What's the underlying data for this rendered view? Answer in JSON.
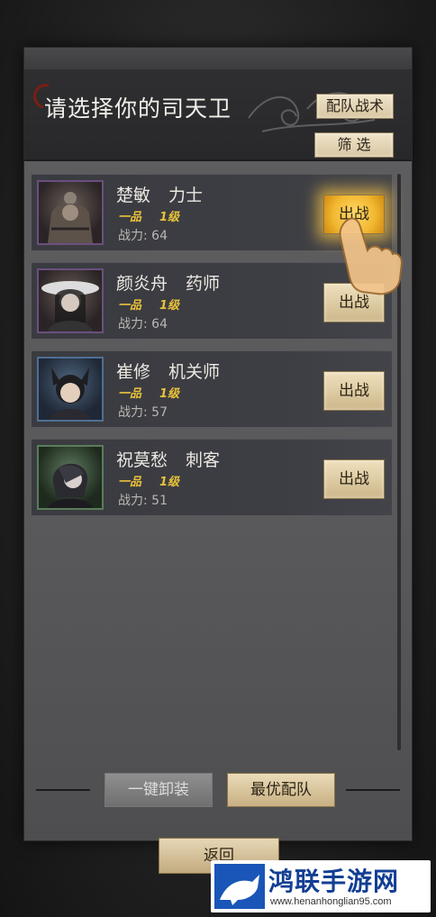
{
  "header": {
    "title": "请选择你的司天卫",
    "tactics_button": "配队战术",
    "filter_button": "筛 选"
  },
  "guards": [
    {
      "name": "楚敏",
      "role": "力士",
      "rank": "一品",
      "level": "1级",
      "power": "战力: 64",
      "action": "出战",
      "frame_color": "#6a4f7e",
      "highlighted": true
    },
    {
      "name": "颜炎舟",
      "role": "药师",
      "rank": "一品",
      "level": "1级",
      "power": "战力: 64",
      "action": "出战",
      "frame_color": "#6a4f7e",
      "highlighted": false
    },
    {
      "name": "崔修",
      "role": "机关师",
      "rank": "一品",
      "level": "1级",
      "power": "战力: 57",
      "action": "出战",
      "frame_color": "#4e6f94",
      "highlighted": false
    },
    {
      "name": "祝莫愁",
      "role": "刺客",
      "rank": "一品",
      "level": "1级",
      "power": "战力: 51",
      "action": "出战",
      "frame_color": "#5a7d5a",
      "highlighted": false
    }
  ],
  "footer": {
    "unequip_all": "一键卸装",
    "optimal_team": "最优配队",
    "return": "返回"
  },
  "watermark": {
    "title": "鸿联手游网",
    "url": "www.henanhonglian95.com"
  }
}
